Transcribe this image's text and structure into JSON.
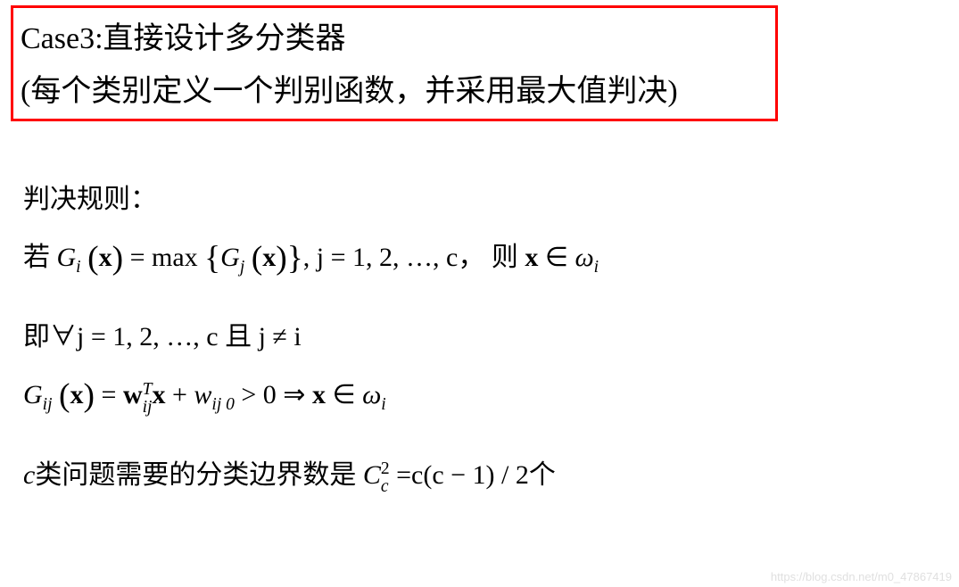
{
  "header": {
    "line1": "Case3:直接设计多分类器",
    "line2": "(每个类别定义一个判别函数，并采用最大值判决)"
  },
  "body": {
    "rule_label": "判决规则：",
    "rule_prefix": "若",
    "rule_jrange": ", j = 1, 2, …, c，",
    "rule_then": "则",
    "forall_prefix": "即∀j = 1, 2, …, c 且 j ≠ i",
    "boundary_prefix": "c类问题需要的分类边界数是",
    "boundary_suffix": "个"
  },
  "math": {
    "G": "G",
    "x": "x",
    "w": "w",
    "max": "max",
    "i": "i",
    "j": "j",
    "ij": "ij",
    "ij0": "ij 0",
    "T": "T",
    "eq": "=",
    "gt": "> 0",
    "imply": "⇒",
    "in": "∈",
    "omega": "ω",
    "C": "C",
    "c": "c",
    "two": "2",
    "formula_rhs": "c(c − 1) / 2"
  },
  "watermark": "https://blog.csdn.net/m0_47867419"
}
